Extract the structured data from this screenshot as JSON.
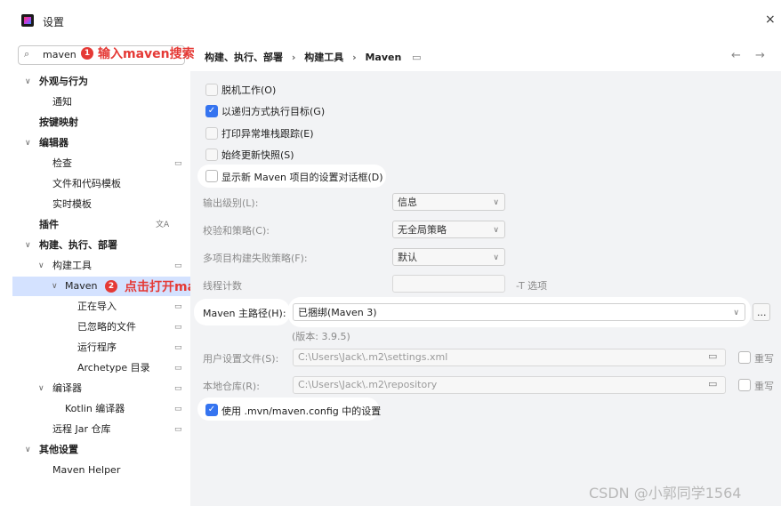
{
  "window": {
    "title": "设置",
    "close": "×"
  },
  "search": {
    "value": "maven",
    "icon": "search-icon"
  },
  "annotations": {
    "step1": {
      "num": "1",
      "text": "输入maven搜索"
    },
    "step2": {
      "num": "2",
      "text": "点击打开maven配置项"
    }
  },
  "breadcrumb": {
    "part1": "构建、执行、部署",
    "sep": "›",
    "part2": "构建工具",
    "part3": "Maven",
    "nav": "← →"
  },
  "sidebar": {
    "items": [
      {
        "label": "外观与行为",
        "chev": "∨"
      },
      {
        "label": "通知"
      },
      {
        "label": "按键映射"
      },
      {
        "label": "编辑器",
        "chev": "∨"
      },
      {
        "label": "检查"
      },
      {
        "label": "文件和代码模板"
      },
      {
        "label": "实时模板"
      },
      {
        "label": "插件"
      },
      {
        "label": "构建、执行、部署",
        "chev": "∨"
      },
      {
        "label": "构建工具",
        "chev": "∨"
      },
      {
        "label": "Maven",
        "chev": "∨"
      },
      {
        "label": "正在导入"
      },
      {
        "label": "已忽略的文件"
      },
      {
        "label": "运行程序"
      },
      {
        "label": "Archetype 目录"
      },
      {
        "label": "编译器",
        "chev": "∨"
      },
      {
        "label": "Kotlin 编译器"
      },
      {
        "label": "远程 Jar 仓库"
      },
      {
        "label": "其他设置",
        "chev": "∨"
      },
      {
        "label": "Maven Helper"
      }
    ]
  },
  "options": {
    "offline": "脱机工作(O)",
    "recursive": "以递归方式执行目标(G)",
    "stacktrace": "打印异常堆栈跟踪(E)",
    "snapshots": "始终更新快照(S)",
    "show_dialog": "显示新 Maven 项目的设置对话框(D)"
  },
  "form": {
    "output_level_label": "输出级别(L):",
    "output_level_value": "信息",
    "checksum_label": "校验和策略(C):",
    "checksum_value": "无全局策略",
    "failure_label": "多项目构建失败策略(F):",
    "failure_value": "默认",
    "threads_label": "线程计数",
    "threads_suffix": "-T 选项",
    "home_label": "Maven 主路径(H):",
    "home_value": "已捆绑(Maven 3)",
    "home_browse": "...",
    "version": "(版本: 3.9.5)",
    "settings_label": "用户设置文件(S):",
    "settings_value": "C:\\Users\\Jack\\.m2\\settings.xml",
    "repo_label": "本地仓库(R):",
    "repo_value": "C:\\Users\\Jack\\.m2\\repository",
    "override": "重写",
    "mvn_config": "使用 .mvn/maven.config 中的设置"
  },
  "watermark": "CSDN @小郭同学1564"
}
